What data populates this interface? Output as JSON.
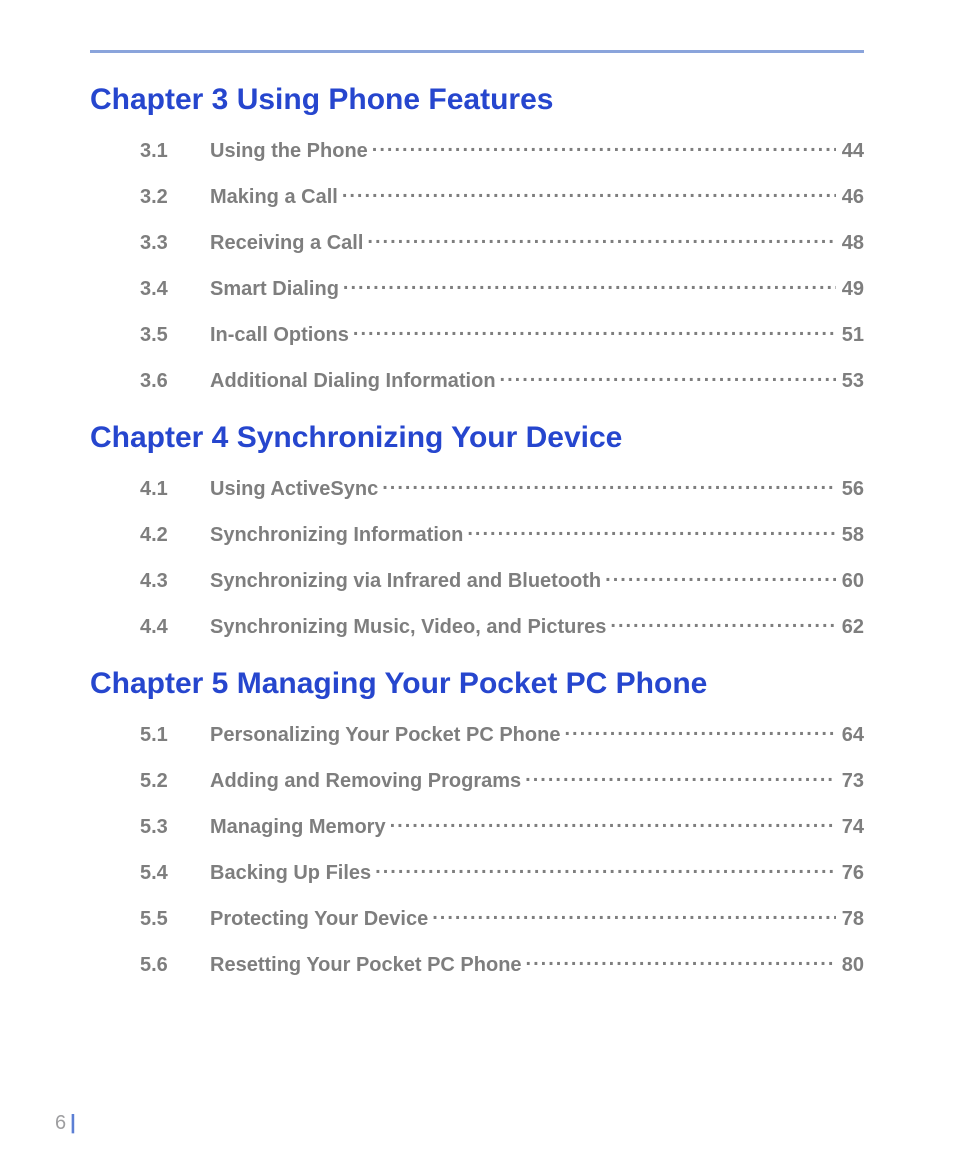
{
  "page_number": "6",
  "chapters": [
    {
      "title": "Chapter 3  Using Phone Features",
      "entries": [
        {
          "num": "3.1",
          "label": "Using the Phone",
          "page": "44"
        },
        {
          "num": "3.2",
          "label": "Making a Call",
          "page": "46"
        },
        {
          "num": "3.3",
          "label": "Receiving a Call",
          "page": "48"
        },
        {
          "num": "3.4",
          "label": "Smart Dialing",
          "page": "49"
        },
        {
          "num": "3.5",
          "label": "In-call Options",
          "page": "51"
        },
        {
          "num": "3.6",
          "label": "Additional Dialing Information",
          "page": "53"
        }
      ]
    },
    {
      "title": "Chapter 4  Synchronizing Your Device",
      "entries": [
        {
          "num": "4.1",
          "label": "Using ActiveSync",
          "page": "56"
        },
        {
          "num": "4.2",
          "label": "Synchronizing Information",
          "page": "58"
        },
        {
          "num": "4.3",
          "label": "Synchronizing via Infrared and Bluetooth",
          "page": "60"
        },
        {
          "num": "4.4",
          "label": "Synchronizing Music, Video, and Pictures",
          "page": "62"
        }
      ]
    },
    {
      "title": "Chapter 5  Managing Your Pocket PC Phone",
      "entries": [
        {
          "num": "5.1",
          "label": "Personalizing Your Pocket PC Phone",
          "page": "64"
        },
        {
          "num": "5.2",
          "label": "Adding and Removing Programs",
          "page": "73"
        },
        {
          "num": "5.3",
          "label": "Managing Memory",
          "page": "74"
        },
        {
          "num": "5.4",
          "label": "Backing Up Files",
          "page": "76"
        },
        {
          "num": "5.5",
          "label": "Protecting Your Device",
          "page": "78"
        },
        {
          "num": "5.6",
          "label": "Resetting Your Pocket PC Phone",
          "page": "80"
        }
      ]
    }
  ]
}
